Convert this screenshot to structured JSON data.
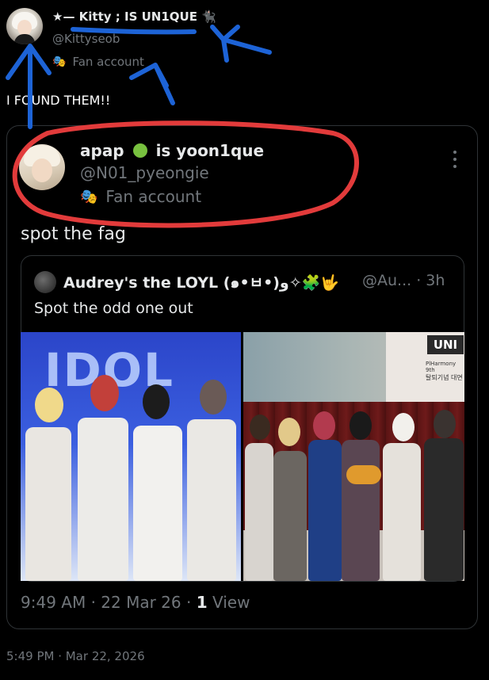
{
  "outer_tweet": {
    "display_name": "★— Kitty ; IS UN1QUE 🐈‍⬛",
    "handle": "@Kittyseob",
    "badge": "Fan account",
    "text": "I FOUND THEM!!",
    "timestamp": "5:49 PM · Mar 22, 2026"
  },
  "quoted_tweet": {
    "display_name_a": "apap",
    "display_name_b": "is yoon1que",
    "handle": "@N01_pyeongie",
    "badge": "Fan account",
    "text": "spot the fag",
    "time": "9:49 AM · 22 Mar 26 · ",
    "views_count": "1",
    "views_label": " View"
  },
  "nested_quote": {
    "display_name": "Audrey's the LOYL (๑•ㅂ•)و✧🧩🤟",
    "handle_and_time": "@Au... · 3h",
    "text": "Spot the odd one out"
  },
  "photos": {
    "left_sign": "IDOL",
    "right_logo": "UNI",
    "right_sub": "PlHarmony 9th",
    "right_sub2": "탈퇴기념 대면"
  },
  "icons": {
    "badge_icon": "theater-mask-icon",
    "more_icon": "more-vertical-icon",
    "apple_icon": "green-apple-icon"
  },
  "colors": {
    "background": "#000000",
    "muted": "#71767b",
    "annotation_red": "#e23b3b",
    "annotation_blue": "#1d63d6"
  }
}
